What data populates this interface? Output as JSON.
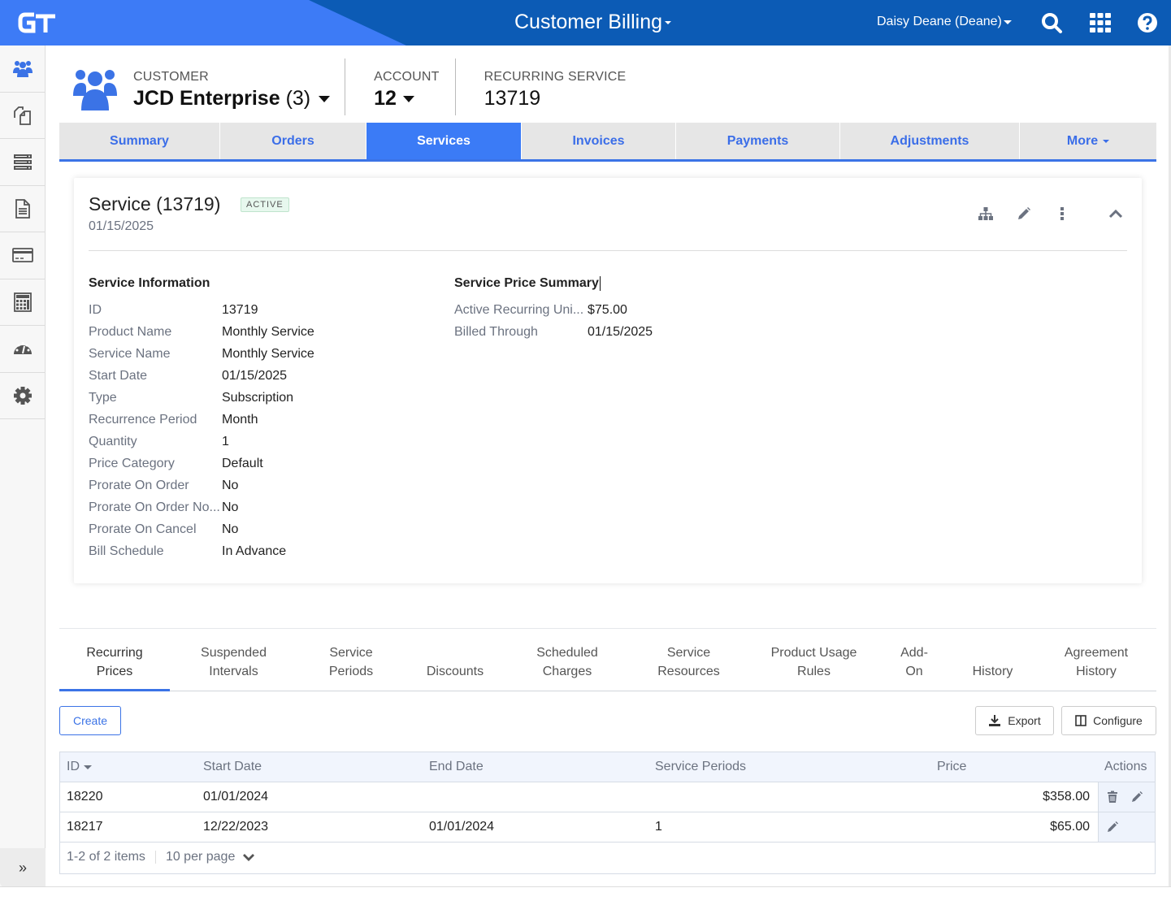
{
  "topbar": {
    "logo": "GT",
    "app_title": "Customer Billing",
    "user": "Daisy Deane (Deane)",
    "icons": [
      "search-icon",
      "apps-grid-icon",
      "help-icon"
    ]
  },
  "sidebar": {
    "items": [
      {
        "icon": "customers-icon",
        "active": true
      },
      {
        "icon": "copy-documents-icon"
      },
      {
        "icon": "servers-icon"
      },
      {
        "icon": "document-icon"
      },
      {
        "icon": "credit-card-icon"
      },
      {
        "icon": "calculator-icon"
      },
      {
        "icon": "dashboard-gauge-icon"
      },
      {
        "icon": "gear-icon"
      }
    ],
    "expand_label": "»"
  },
  "header": {
    "customer_label": "CUSTOMER",
    "customer_name": "JCD Enterprise",
    "customer_count": "(3)",
    "account_label": "ACCOUNT",
    "account_value": "12",
    "service_label": "RECURRING SERVICE",
    "service_value": "13719"
  },
  "main_tabs": [
    {
      "label": "Summary"
    },
    {
      "label": "Orders"
    },
    {
      "label": "Services",
      "active": true
    },
    {
      "label": "Invoices"
    },
    {
      "label": "Payments"
    },
    {
      "label": "Adjustments"
    },
    {
      "label": "More"
    }
  ],
  "service": {
    "title": "Service (13719)",
    "status": "ACTIVE",
    "date": "01/15/2025",
    "info_title": "Service Information",
    "info": [
      {
        "k": "ID",
        "v": "13719"
      },
      {
        "k": "Product Name",
        "v": "Monthly Service"
      },
      {
        "k": "Service Name",
        "v": "Monthly Service"
      },
      {
        "k": "Start Date",
        "v": "01/15/2025"
      },
      {
        "k": "Type",
        "v": "Subscription"
      },
      {
        "k": "Recurrence Period",
        "v": "Month"
      },
      {
        "k": "Quantity",
        "v": "1"
      },
      {
        "k": "Price Category",
        "v": "Default"
      },
      {
        "k": "Prorate On Order",
        "v": "No"
      },
      {
        "k": "Prorate On Order No...",
        "v": "No"
      },
      {
        "k": "Prorate On Cancel",
        "v": "No"
      },
      {
        "k": "Bill Schedule",
        "v": "In Advance"
      }
    ],
    "price_title": "Service Price Summary",
    "price": [
      {
        "k": "Active Recurring Uni...",
        "v": "$75.00"
      },
      {
        "k": "Billed Through",
        "v": "01/15/2025"
      }
    ]
  },
  "sub_tabs": [
    {
      "l1": "Recurring",
      "l2": "Prices",
      "active": true
    },
    {
      "l1": "Suspended",
      "l2": "Intervals"
    },
    {
      "l1": "Service",
      "l2": "Periods"
    },
    {
      "l1": "",
      "l2": "Discounts"
    },
    {
      "l1": "Scheduled",
      "l2": "Charges"
    },
    {
      "l1": "Service",
      "l2": "Resources"
    },
    {
      "l1": "Product Usage",
      "l2": "Rules"
    },
    {
      "l1": "Add-",
      "l2": "On"
    },
    {
      "l1": "",
      "l2": "History"
    },
    {
      "l1": "Agreement",
      "l2": "History"
    }
  ],
  "toolbar": {
    "create": "Create",
    "export": "Export",
    "configure": "Configure"
  },
  "table": {
    "columns": [
      "ID",
      "Start Date",
      "End Date",
      "Service Periods",
      "Price",
      "Actions"
    ],
    "rows": [
      {
        "id": "18220",
        "start": "01/01/2024",
        "end": "",
        "periods": "",
        "price": "$358.00",
        "actions": [
          "delete",
          "edit"
        ]
      },
      {
        "id": "18217",
        "start": "12/22/2023",
        "end": "01/01/2024",
        "periods": "1",
        "price": "$65.00",
        "actions": [
          "edit"
        ]
      }
    ],
    "pager_text": "1-2 of 2 items",
    "per_page": "10 per page"
  }
}
